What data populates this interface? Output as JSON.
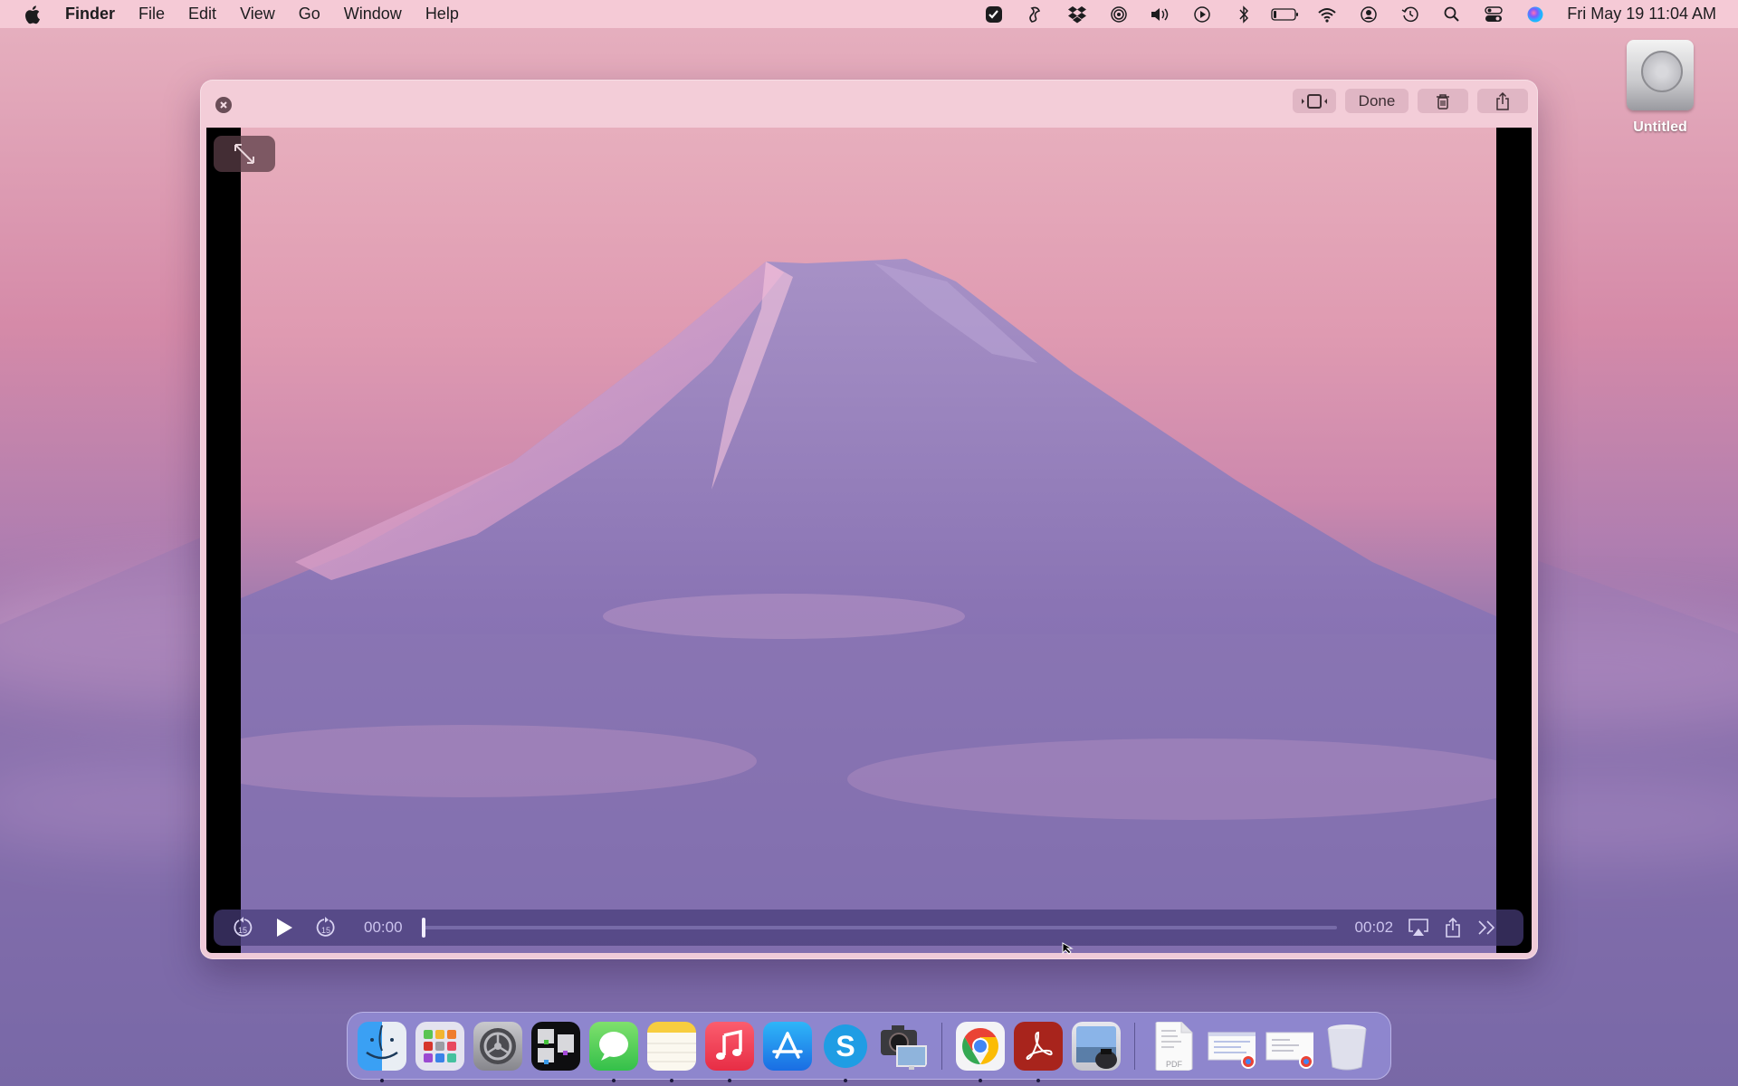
{
  "menubar": {
    "apple_icon": "apple-logo",
    "app_name": "Finder",
    "menus": [
      "File",
      "Edit",
      "View",
      "Go",
      "Window",
      "Help"
    ],
    "status_icons": [
      "checklist-icon",
      "script-icon",
      "dropbox-icon",
      "airdrop-icon",
      "volume-icon",
      "play-icon",
      "bluetooth-icon",
      "battery-icon",
      "wifi-icon",
      "user-icon",
      "time-machine-icon",
      "search-icon",
      "control-center-icon",
      "siri-icon"
    ],
    "clock": "Fri May 19  11:04 AM"
  },
  "desktop": {
    "drive_label": "Untitled"
  },
  "quicklook": {
    "toolbar": {
      "trim_icon": "trim-icon",
      "done_label": "Done",
      "delete_icon": "trash-icon",
      "share_icon": "share-icon"
    },
    "player": {
      "current_time": "00:00",
      "duration": "00:02",
      "progress": 0.0
    }
  },
  "dock": {
    "apps": [
      {
        "name": "Finder",
        "running": true
      },
      {
        "name": "Launchpad",
        "running": false
      },
      {
        "name": "System Settings",
        "running": false
      },
      {
        "name": "Mission Control",
        "running": false
      },
      {
        "name": "Messages",
        "running": true
      },
      {
        "name": "Notes",
        "running": true
      },
      {
        "name": "Music",
        "running": true
      },
      {
        "name": "App Store",
        "running": false
      },
      {
        "name": "Skype",
        "running": true
      },
      {
        "name": "Screenshot",
        "running": false
      }
    ],
    "apps2": [
      {
        "name": "Google Chrome",
        "running": true
      },
      {
        "name": "Adobe Acrobat",
        "running": true
      },
      {
        "name": "Preview",
        "running": false
      }
    ],
    "stack_items": [
      {
        "name": "PDF document",
        "badge": "PDF"
      },
      {
        "name": "Chrome window 1"
      },
      {
        "name": "Chrome window 2"
      },
      {
        "name": "Trash"
      }
    ]
  }
}
